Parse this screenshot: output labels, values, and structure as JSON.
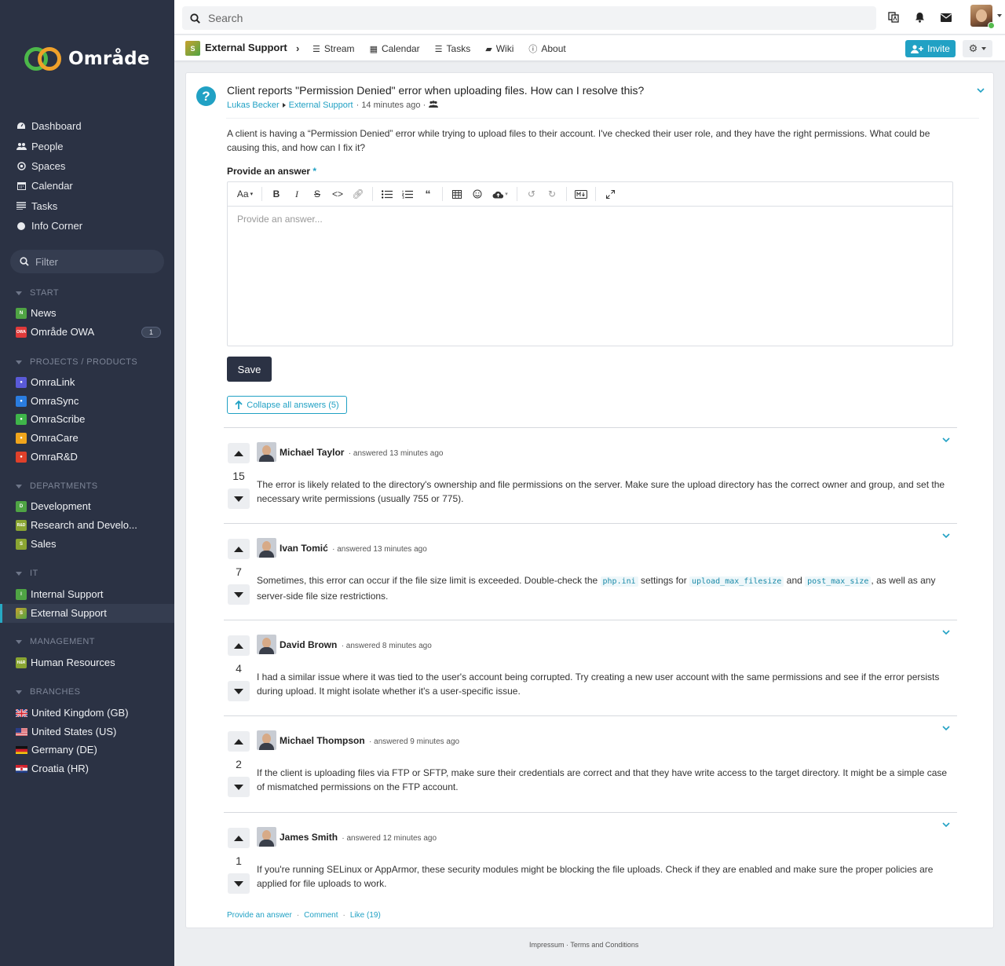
{
  "app": {
    "name": "Område"
  },
  "sidebar": {
    "nav": [
      {
        "label": "Dashboard",
        "icon": "dashboard-icon"
      },
      {
        "label": "People",
        "icon": "people-icon"
      },
      {
        "label": "Spaces",
        "icon": "spaces-icon"
      },
      {
        "label": "Calendar",
        "icon": "calendar-icon"
      },
      {
        "label": "Tasks",
        "icon": "tasks-icon"
      },
      {
        "label": "Info Corner",
        "icon": "info-corner-icon"
      }
    ],
    "filter_placeholder": "Filter",
    "sections": [
      {
        "title": "START",
        "items": [
          {
            "label": "News",
            "badge": "N",
            "color": "#4fa444"
          },
          {
            "label": "Område OWA",
            "badge": "OWA",
            "color": "#e03a3a",
            "count": "1"
          }
        ]
      },
      {
        "title": "PROJECTS / PRODUCTS",
        "items": [
          {
            "label": "OmraLink",
            "color": "#5a5ad8"
          },
          {
            "label": "OmraSync",
            "color": "#2a7de0"
          },
          {
            "label": "OmraScribe",
            "color": "#3fb54a"
          },
          {
            "label": "OmraCare",
            "color": "#f0a51c"
          },
          {
            "label": "OmraR&D",
            "color": "#e0402a"
          }
        ]
      },
      {
        "title": "DEPARTMENTS",
        "items": [
          {
            "label": "Development",
            "badge": "D",
            "color": "#4fa444"
          },
          {
            "label": "Research and Develo...",
            "badge": "R&D",
            "color": "#8aa532"
          },
          {
            "label": "Sales",
            "badge": "S",
            "color": "#8aa532"
          }
        ]
      },
      {
        "title": "IT",
        "items": [
          {
            "label": "Internal Support",
            "badge": "I",
            "color": "#4fa444"
          },
          {
            "label": "External Support",
            "badge": "S",
            "color": "#a0a02a",
            "active": true
          }
        ]
      },
      {
        "title": "MANAGEMENT",
        "items": [
          {
            "label": "Human Resources",
            "badge": "H&R",
            "color": "#8aa532"
          }
        ]
      },
      {
        "title": "BRANCHES",
        "items": [
          {
            "label": "United Kingdom (GB)",
            "flag": "gb"
          },
          {
            "label": "United States (US)",
            "flag": "us"
          },
          {
            "label": "Germany (DE)",
            "flag": "de"
          },
          {
            "label": "Croatia (HR)",
            "flag": "hr"
          }
        ]
      }
    ]
  },
  "topbar": {
    "search_placeholder": "Search"
  },
  "spacebar": {
    "badge": "S",
    "title": "External Support",
    "tabs": [
      {
        "label": "Stream",
        "icon": "stream-icon"
      },
      {
        "label": "Calendar",
        "icon": "calendar-icon"
      },
      {
        "label": "Tasks",
        "icon": "tasks-icon"
      },
      {
        "label": "Wiki",
        "icon": "wiki-icon"
      },
      {
        "label": "About",
        "icon": "about-icon"
      }
    ],
    "invite_label": "Invite"
  },
  "question": {
    "title": "Client reports \"Permission Denied\" error when uploading files. How can I resolve this?",
    "author": "Lukas Becker",
    "space": "External Support",
    "time": "· 14 minutes ago ·",
    "body": "A client is having a “Permission Denied” error while trying to upload files to their account. I've checked their user role, and they have the right permissions. What could be causing this, and how can I fix it?",
    "answer_label": "Provide an answer",
    "required_mark": "*",
    "editor_placeholder": "Provide an answer...",
    "font_button": "Aa",
    "save_label": "Save",
    "collapse_label": "Collapse all answers (5)"
  },
  "answers": [
    {
      "name": "Michael Taylor",
      "when": "· answered 13 minutes ago",
      "votes": "15",
      "text": "The error is likely related to the directory's ownership and file permissions on the server. Make sure the upload directory has the correct owner and group, and set the necessary write permissions (usually 755 or 775)."
    },
    {
      "name": "Ivan Tomić",
      "when": "· answered 13 minutes ago",
      "votes": "7",
      "text_a": "Sometimes, this error can occur if the file size limit is exceeded. Double-check the ",
      "code_1": "php.ini",
      "text_b": " settings for ",
      "code_2": "upload_max_filesize",
      "text_c": " and ",
      "code_3": "post_max_size",
      "text_d": ", as well as any server-side file size restrictions."
    },
    {
      "name": "David Brown",
      "when": "· answered 8 minutes ago",
      "votes": "4",
      "text": "I had a similar issue where it was tied to the user's account being corrupted. Try creating a new user account with the same permissions and see if the error persists during upload. It might isolate whether it's a user-specific issue."
    },
    {
      "name": "Michael Thompson",
      "when": "· answered 9 minutes ago",
      "votes": "2",
      "text": "If the client is uploading files via FTP or SFTP, make sure their credentials are correct and that they have write access to the target directory. It might be a simple case of mismatched permissions on the FTP account."
    },
    {
      "name": "James Smith",
      "when": "· answered 12 minutes ago",
      "votes": "1",
      "text": "If you're running SELinux or AppArmor, these security modules might be blocking the file uploads. Check if they are enabled and make sure the proper policies are applied for file uploads to work."
    }
  ],
  "footer_actions": {
    "answer": "Provide an answer",
    "comment": "Comment",
    "like": "Like (19)"
  },
  "page_footer": {
    "impressum": "Impressum",
    "terms": "Terms and Conditions"
  },
  "colors": {
    "accent": "#21a1c4",
    "sidebar_bg": "#2b3244"
  }
}
